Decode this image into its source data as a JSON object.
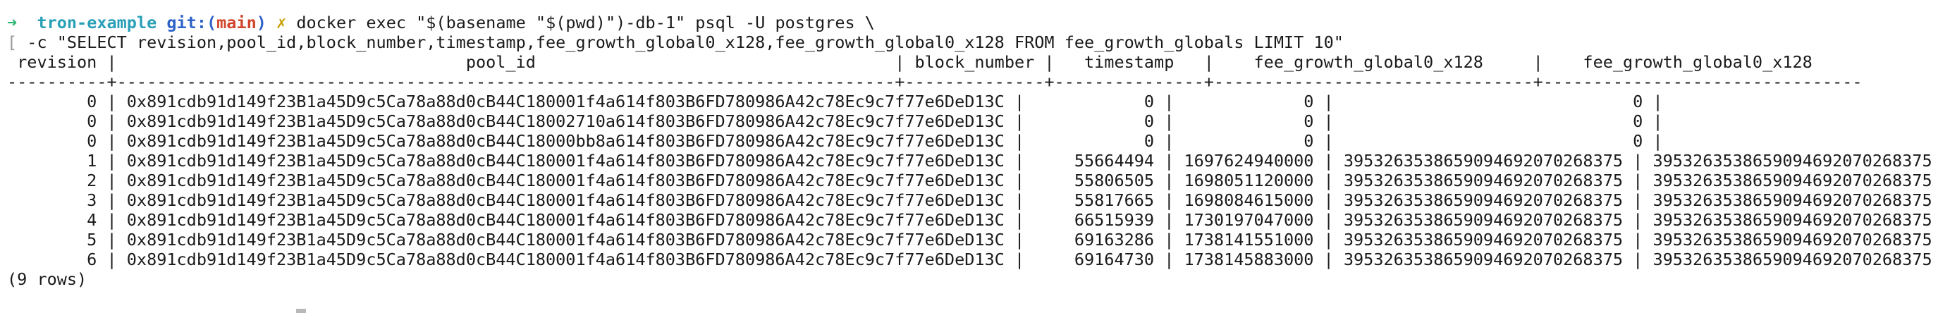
{
  "prompt": {
    "arrow": "➜",
    "directory": "tron-example",
    "git_label": "git:(",
    "branch": "main",
    "git_close": ")",
    "dirty_mark": "✗"
  },
  "command": {
    "line1": "docker exec \"$(basename \"$(pwd)\")-db-1\" psql -U postgres \\",
    "line2_bracket": "[",
    "line2": " -c \"SELECT revision,pool_id,block_number,timestamp,fee_growth_global0_x128,fee_growth_global0_x128 FROM fee_growth_globals LIMIT 10\""
  },
  "table": {
    "header_line": " revision |                                   pool_id                                    | block_number |   timestamp   |    fee_growth_global0_x128     |    fee_growth_global0_x128",
    "separator_line": "----------+------------------------------------------------------------------------------+--------------+---------------+--------------------------------+--------------------------------",
    "rows": [
      "        0 | 0x891cdb91d149f23B1a45D9c5Ca78a88d0cB44C180001f4a614f803B6FD780986A42c78Ec9c7f77e6DeD13C |            0 |             0 |                              0 |                              0",
      "        0 | 0x891cdb91d149f23B1a45D9c5Ca78a88d0cB44C18002710a614f803B6FD780986A42c78Ec9c7f77e6DeD13C |            0 |             0 |                              0 |                              0",
      "        0 | 0x891cdb91d149f23B1a45D9c5Ca78a88d0cB44C18000bb8a614f803B6FD780986A42c78Ec9c7f77e6DeD13C |            0 |             0 |                              0 |                              0",
      "        1 | 0x891cdb91d149f23B1a45D9c5Ca78a88d0cB44C180001f4a614f803B6FD780986A42c78Ec9c7f77e6DeD13C |     55664494 | 1697624940000 | 395326353865909469207026837​5 | 3953263538659094692070268375",
      "        2 | 0x891cdb91d149f23B1a45D9c5Ca78a88d0cB44C180001f4a614f803B6FD780986A42c78Ec9c7f77e6DeD13C |     55806505 | 1698051120000 | 3953263538659094692070268375 | 3953263538659094692070268375",
      "        3 | 0x891cdb91d149f23B1a45D9c5Ca78a88d0cB44C180001f4a614f803B6FD780986A42c78Ec9c7f77e6DeD13C |     55817665 | 1698084615000 | 3953263538659094692070268375 | 3953263538659094692070268375",
      "        4 | 0x891cdb91d149f23B1a45D9c5Ca78a88d0cB44C180001f4a614f803B6FD780986A42c78Ec9c7f77e6DeD13C |     66515939 | 1730197047000 | 3953263538659094692070268375 | 3953263538659094692070268375",
      "        5 | 0x891cdb91d149f23B1a45D9c5Ca78a88d0cB44C180001f4a614f803B6FD780986A42c78Ec9c7f77e6DeD13C |     69163286 | 1738141551000 | 3953263538659094692070268375 | 3953263538659094692070268375",
      "        6 | 0x891cdb91d149f23B1a45D9c5Ca78a88d0cB44C180001f4a614f803B6FD780986A42c78Ec9c7f77e6DeD13C |     69164730 | 1738145883000 | 3953263538659094692070268375 | 3953263538659094692070268375"
    ],
    "row_count": "(9 rows)"
  }
}
